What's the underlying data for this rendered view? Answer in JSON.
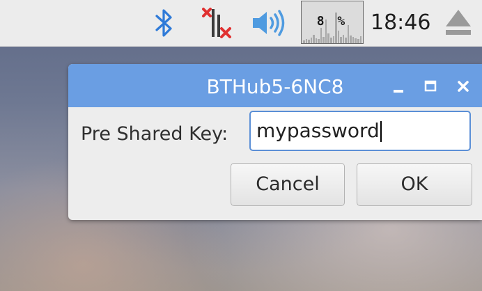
{
  "taskbar": {
    "icons": {
      "bluetooth": "bluetooth-icon",
      "network": "network-disconnected-icon",
      "volume": "volume-icon",
      "eject": "eject-icon"
    },
    "cpu_monitor": {
      "usage_text": "8 %",
      "usage_percent": 8
    },
    "clock": "18:46"
  },
  "dialog": {
    "title": "BTHub5-6NC8",
    "label": "Pre Shared Key:",
    "input_value": "mypassword",
    "cancel_label": "Cancel",
    "ok_label": "OK"
  },
  "colors": {
    "titlebar": "#6a9ee3",
    "bluetooth": "#2f7ad8",
    "network_x": "#e03030",
    "volume": "#4f9be0",
    "input_focus": "#5b8fd6"
  }
}
